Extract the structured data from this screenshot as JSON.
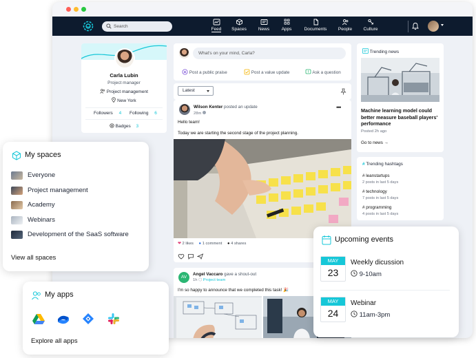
{
  "topbar": {
    "search_placeholder": "Search",
    "nav": [
      {
        "label": "Feed",
        "icon": "feed-icon",
        "active": true
      },
      {
        "label": "Spaces",
        "icon": "spaces-icon"
      },
      {
        "label": "News",
        "icon": "news-icon"
      },
      {
        "label": "Apps",
        "icon": "apps-icon"
      },
      {
        "label": "Documents",
        "icon": "documents-icon"
      },
      {
        "label": "People",
        "icon": "people-icon"
      },
      {
        "label": "Culture",
        "icon": "culture-icon"
      }
    ]
  },
  "profile": {
    "name": "Carla Lubin",
    "title": "Project manager",
    "department": "Project management",
    "location": "New York",
    "followers_label": "Followers",
    "followers_count": "4",
    "following_label": "Following",
    "following_count": "6",
    "badges_label": "Badges",
    "badges_count": "3"
  },
  "composer": {
    "placeholder": "What's on your mind, Carla?",
    "action_praise": "Post a public praise",
    "action_value": "Post a value update",
    "action_question": "Ask a question"
  },
  "feed": {
    "sort_label": "Latest"
  },
  "post1": {
    "author": "Wilson Kenter",
    "action": "posted an update",
    "time": "28m",
    "line1": "Hello team!",
    "line2": "Today we are starting the second stage of the project planning.",
    "likes": "2 likes",
    "comments": "1 comment",
    "shares": "4 shares"
  },
  "post2": {
    "author": "Angel Vaccaro",
    "action": "gave a shout-out",
    "time": "1h",
    "space": "Project team",
    "text": "I'm so happy to announce that we completed this task! 🎉",
    "initials": "AV"
  },
  "trending_news": {
    "header": "Trending news",
    "title": "Machine learning model could better measure baseball players' performance",
    "posted": "Posted 2h ago",
    "link": "Go to news →"
  },
  "hashtags": {
    "header": "Trending hashtags",
    "items": [
      {
        "tag": "leanstartups",
        "meta": "2 posts in last 5 days"
      },
      {
        "tag": "technology",
        "meta": "7 posts in last 5 days"
      },
      {
        "tag": "programming",
        "meta": "4 posts in last 5 days"
      }
    ]
  },
  "my_spaces": {
    "title": "My spaces",
    "items": [
      "Everyone",
      "Project management",
      "Academy",
      "Webinars",
      "Development of the SaaS software"
    ],
    "view_all": "View all spaces"
  },
  "my_apps": {
    "title": "My apps",
    "apps": [
      "google-drive-icon",
      "confluence-icon",
      "jira-icon",
      "slack-icon"
    ],
    "explore": "Explore all apps"
  },
  "events": {
    "title": "Upcoming events",
    "items": [
      {
        "month": "MAY",
        "day": "23",
        "name": "Weekly dicussion",
        "time": "9-10am"
      },
      {
        "month": "MAY",
        "day": "24",
        "name": "Webinar",
        "time": "11am-3pm"
      }
    ]
  },
  "colors": {
    "accent": "#16c7d8",
    "topbar": "#0d1b2e",
    "like": "#e0457b",
    "link_blue": "#2f6fde"
  }
}
